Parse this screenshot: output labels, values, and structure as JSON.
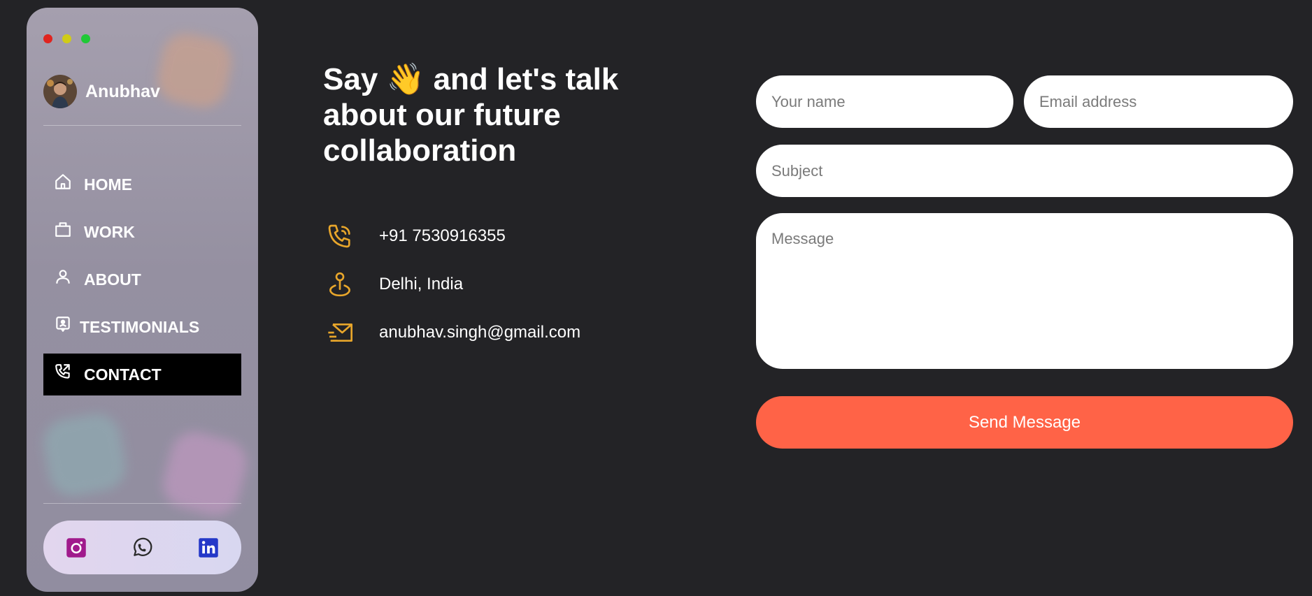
{
  "sidebar": {
    "profile_name": "Anubhav",
    "nav": [
      {
        "label": "HOME",
        "icon": "home-icon"
      },
      {
        "label": "WORK",
        "icon": "briefcase-icon"
      },
      {
        "label": "ABOUT",
        "icon": "user-icon"
      },
      {
        "label": "TESTIMONIALS",
        "icon": "testimonial-icon"
      },
      {
        "label": "CONTACT",
        "icon": "phone-outgoing-icon",
        "active": true
      }
    ],
    "social": [
      "instagram-icon",
      "whatsapp-icon",
      "linkedin-icon"
    ]
  },
  "contact": {
    "heading_part1": "Say",
    "heading_emoji": "👋",
    "heading_part2": "and let's talk about our future collaboration",
    "phone": "+91 7530916355",
    "location": "Delhi, India",
    "email": "anubhav.singh@gmail.com"
  },
  "form": {
    "name_placeholder": "Your name",
    "email_placeholder": "Email address",
    "subject_placeholder": "Subject",
    "message_placeholder": "Message",
    "submit_label": "Send Message"
  },
  "colors": {
    "background": "#232326",
    "accent_icons": "#e8a62b",
    "send_button": "#ff6347",
    "active_nav": "#000000"
  }
}
